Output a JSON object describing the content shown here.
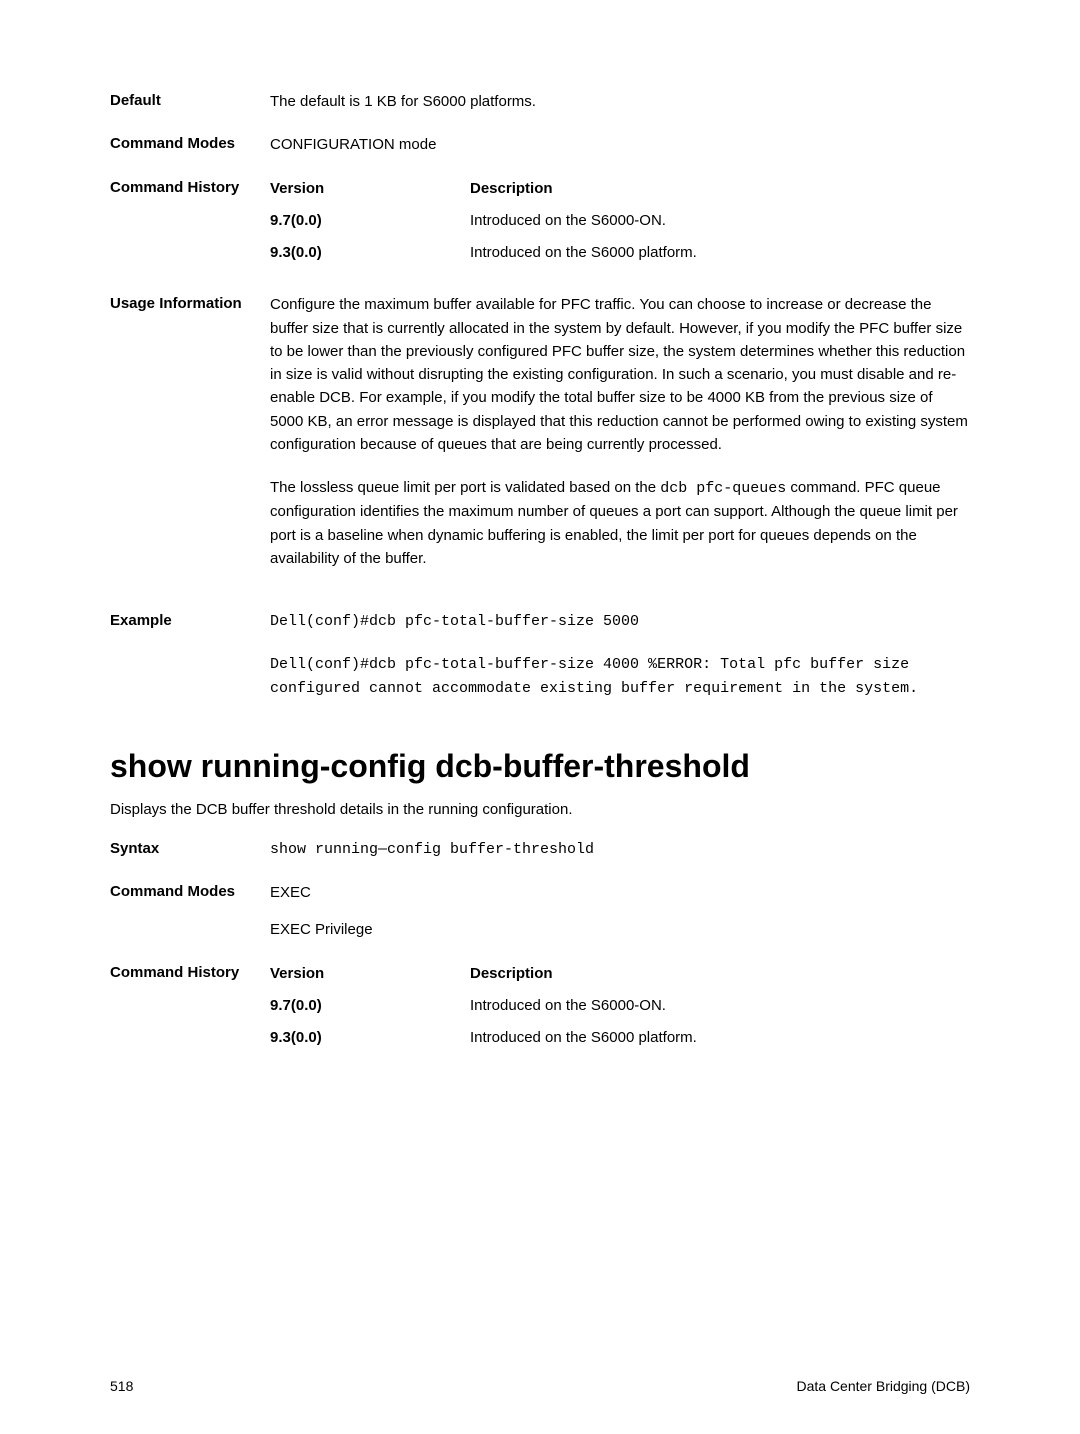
{
  "sections": {
    "default": {
      "label": "Default",
      "value": "The default is 1 KB for S6000 platforms."
    },
    "commandModes": {
      "label": "Command Modes",
      "value": "CONFIGURATION mode"
    },
    "commandHistory": {
      "label": "Command History",
      "header": {
        "version": "Version",
        "desc": "Description"
      },
      "rows": [
        {
          "version": "9.7(0.0)",
          "desc": "Introduced on the S6000-ON."
        },
        {
          "version": "9.3(0.0)",
          "desc": "Introduced on the S6000 platform."
        }
      ]
    },
    "usage": {
      "label": "Usage Information",
      "para1": "Configure the maximum buffer available for PFC traffic. You can choose to increase or decrease the buffer size that is currently allocated in the system by default. However, if you modify the PFC buffer size to be lower than the previously configured PFC buffer size, the system determines whether this reduction in size is valid without disrupting the existing configuration. In such a scenario, you must disable and re-enable DCB. For example, if you modify the total buffer size to be 4000 KB from the previous size of 5000 KB, an error message is displayed that this reduction cannot be performed owing to existing system configuration because of queues that are being currently processed.",
      "para2_pre": "The lossless queue limit per port is validated based on the ",
      "para2_code": "dcb pfc-queues",
      "para2_post": " command. PFC queue configuration identifies the maximum number of queues a port can support. Although the queue limit per port is a baseline when dynamic buffering is enabled, the limit per port for queues depends on the availability of the buffer."
    },
    "example": {
      "label": "Example",
      "line1": "Dell(conf)#dcb pfc-total-buffer-size 5000",
      "block": "Dell(conf)#dcb pfc-total-buffer-size 4000 %ERROR: Total pfc buffer size configured cannot accommodate existing buffer requirement in the system."
    }
  },
  "heading": "show running-config dcb-buffer-threshold",
  "intro": "Displays the DCB buffer threshold details in the running configuration.",
  "sections2": {
    "syntax": {
      "label": "Syntax",
      "value": "show running—config buffer-threshold"
    },
    "modes": {
      "label": "Command Modes",
      "line1": "EXEC",
      "line2": "EXEC Privilege"
    },
    "history": {
      "label": "Command History",
      "header": {
        "version": "Version",
        "desc": "Description"
      },
      "rows": [
        {
          "version": "9.7(0.0)",
          "desc": "Introduced on the S6000-ON."
        },
        {
          "version": "9.3(0.0)",
          "desc": "Introduced on the S6000 platform."
        }
      ]
    }
  },
  "footer": {
    "page": "518",
    "section": "Data Center Bridging (DCB)"
  }
}
